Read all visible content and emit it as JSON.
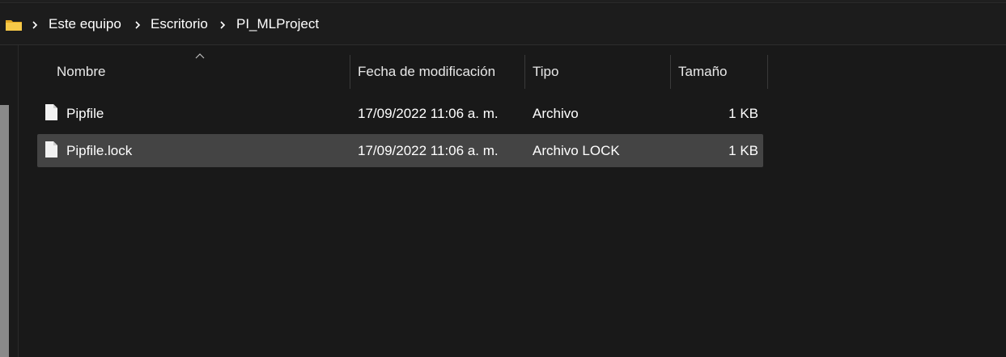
{
  "breadcrumb": {
    "items": [
      {
        "label": "Este equipo"
      },
      {
        "label": "Escritorio"
      },
      {
        "label": "PI_MLProject"
      }
    ]
  },
  "columns": {
    "name": "Nombre",
    "modified": "Fecha de modificación",
    "type": "Tipo",
    "size": "Tamaño"
  },
  "files": [
    {
      "name": "Pipfile",
      "modified": "17/09/2022 11:06 a. m.",
      "type": "Archivo",
      "size": "1 KB",
      "selected": false
    },
    {
      "name": "Pipfile.lock",
      "modified": "17/09/2022 11:06 a. m.",
      "type": "Archivo LOCK",
      "size": "1 KB",
      "selected": true
    }
  ],
  "colors": {
    "background": "#191919",
    "selection": "#444444",
    "folder": "#f2c14e"
  },
  "icons": {
    "folder": "folder-icon",
    "separator": "chevron-right-icon",
    "sort": "sort-ascending-icon",
    "file": "file-icon"
  }
}
